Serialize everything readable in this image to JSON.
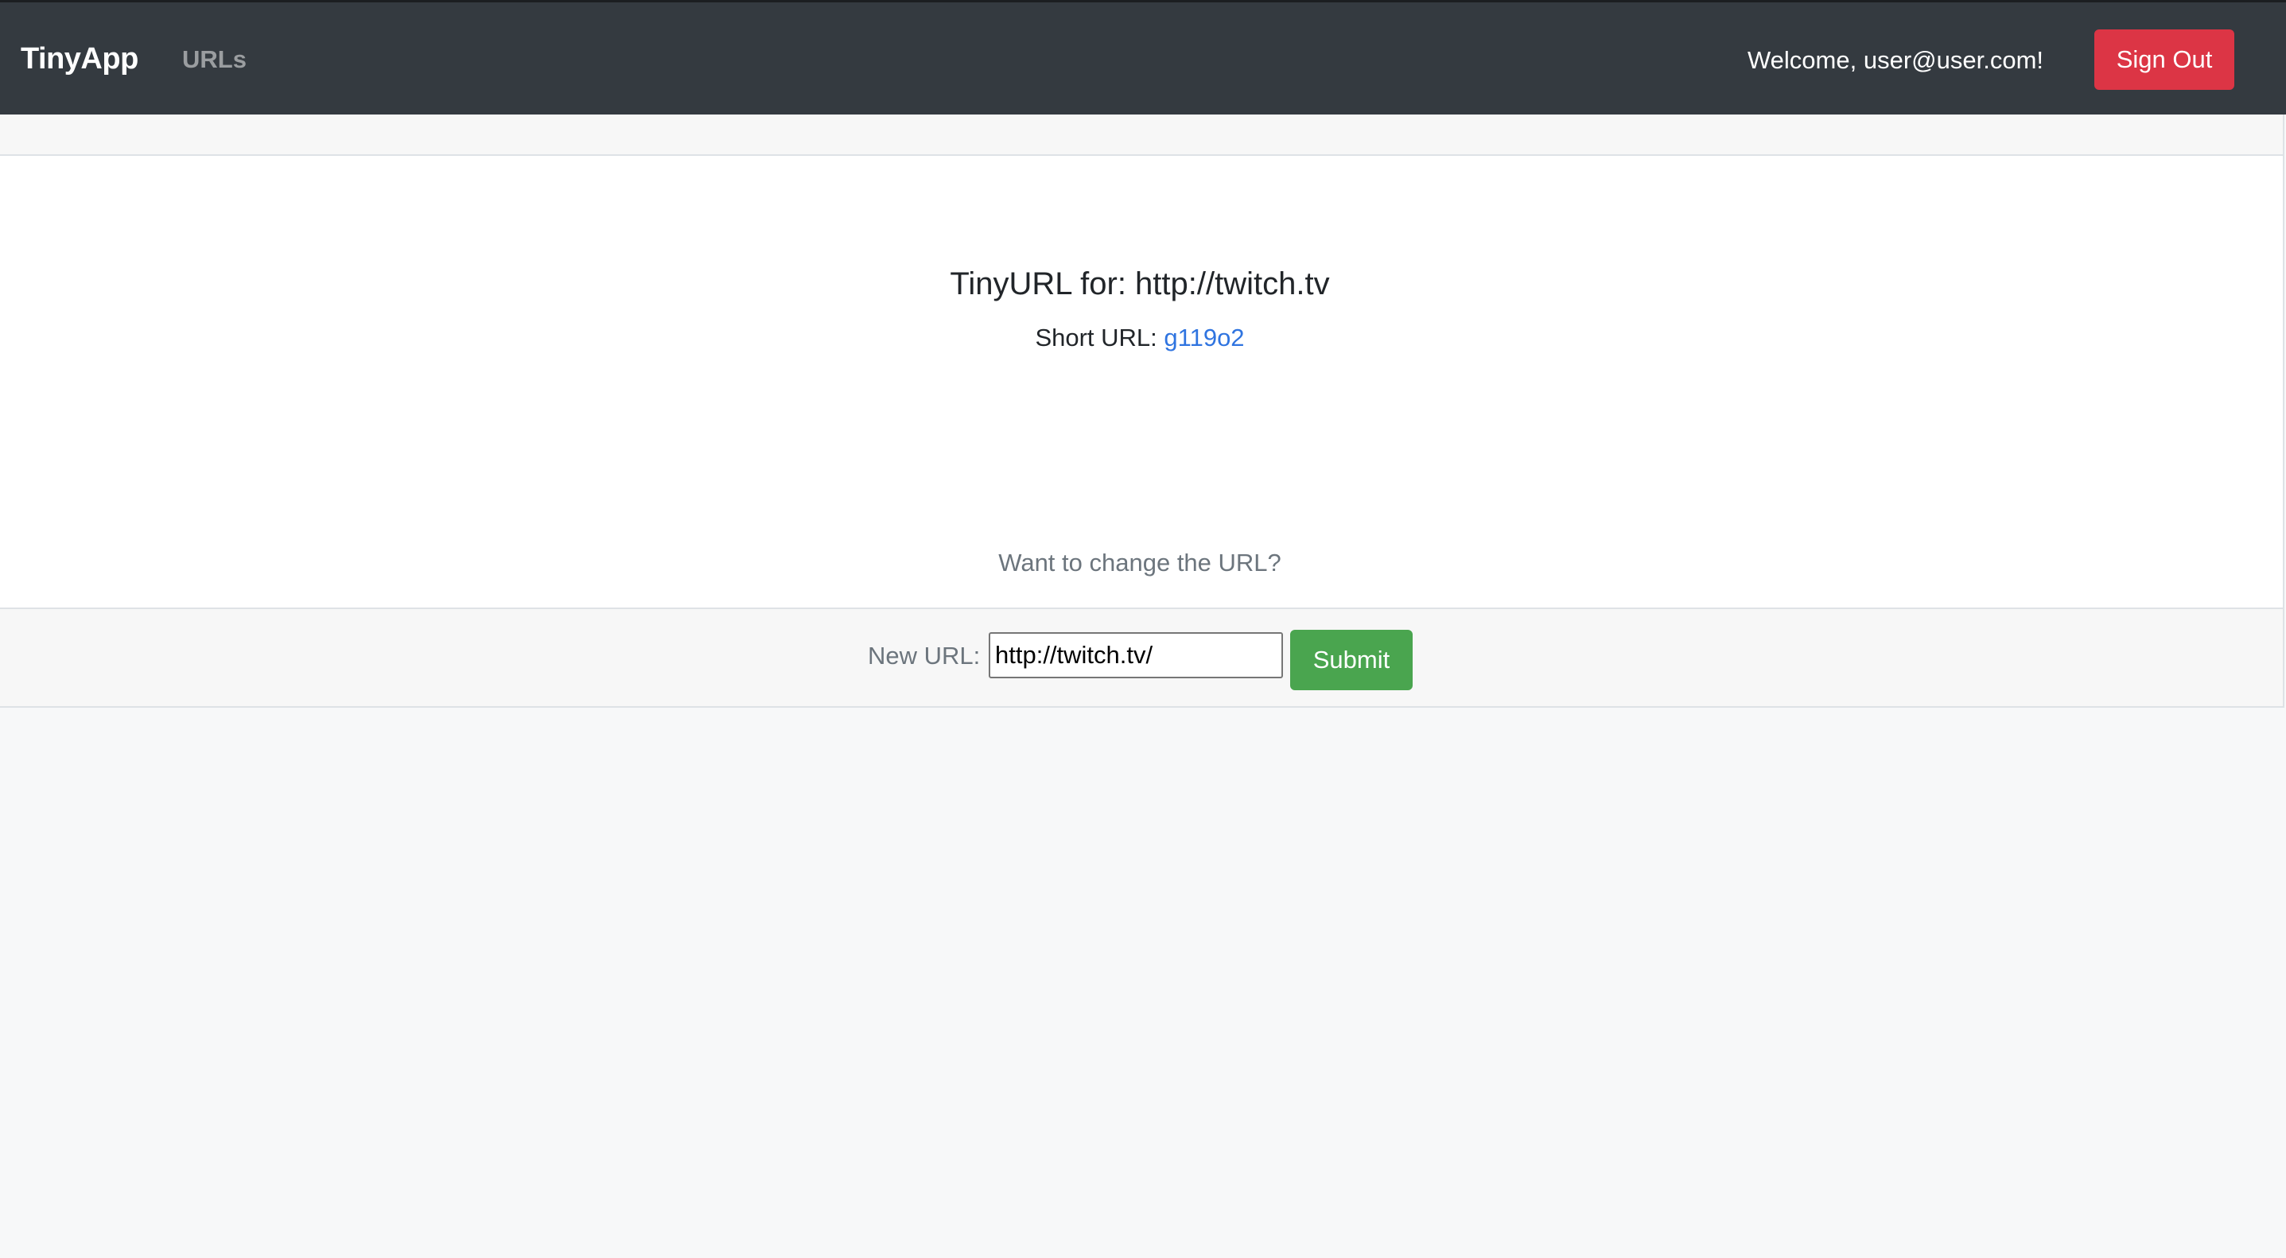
{
  "navbar": {
    "brand": "TinyApp",
    "nav_link": "URLs",
    "welcome_text": "Welcome, user@user.com!",
    "signout_label": "Sign Out"
  },
  "card": {
    "title": "TinyURL for: http://twitch.tv",
    "short_url_label": "Short URL:",
    "short_url_value": "g119o2",
    "change_prompt": "Want to change the URL?"
  },
  "form": {
    "label": "New URL:",
    "input_value": "http://twitch.tv/",
    "submit_label": "Submit"
  },
  "colors": {
    "navbar_bg": "#343a40",
    "signout_bg": "#dc3545",
    "submit_bg": "#4aa54f",
    "link": "#2f74e0",
    "page_bg": "#f7f8f9"
  }
}
